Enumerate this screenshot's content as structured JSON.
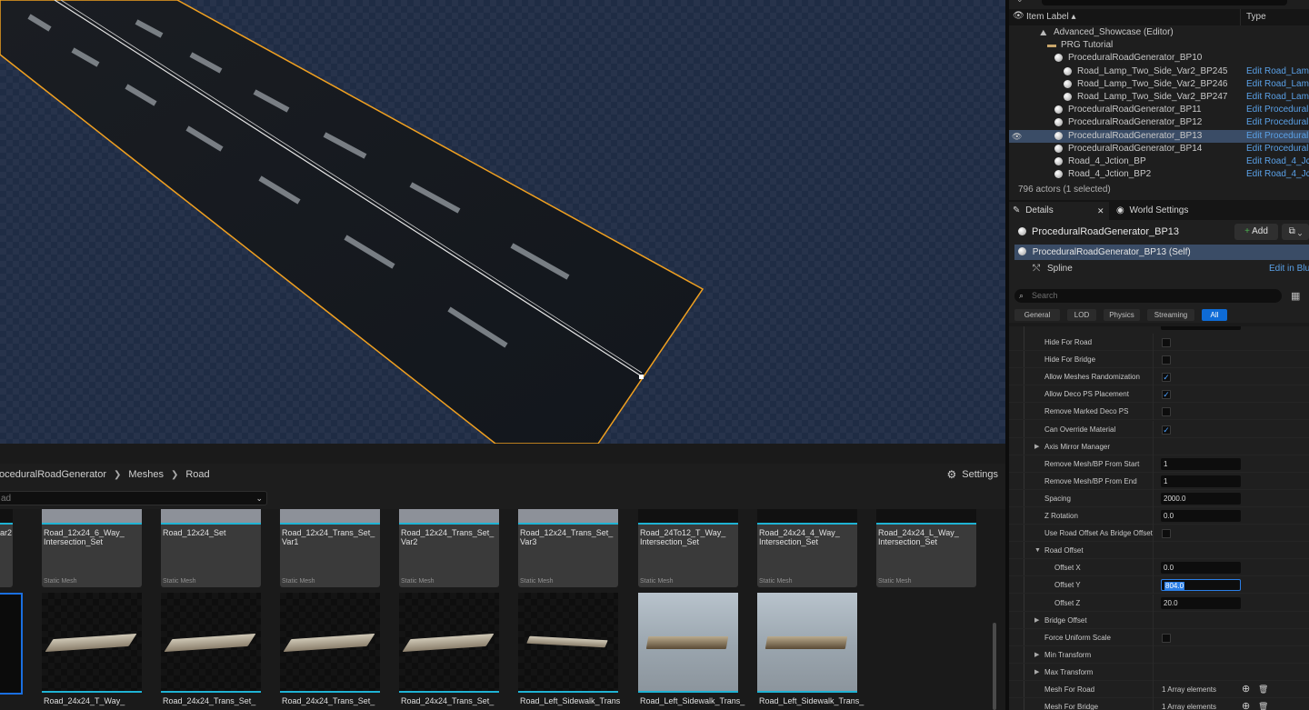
{
  "outliner": {
    "header": {
      "item_label": "Item Label ▴",
      "type": "Type"
    },
    "rows": [
      {
        "label": "Advanced_Showcase (Editor)",
        "type": ""
      },
      {
        "label": "PRG Tutorial",
        "type": ""
      },
      {
        "label": "ProceduralRoadGenerator_BP10",
        "type": ""
      },
      {
        "label": "Road_Lamp_Two_Side_Var2_BP245",
        "type": "Edit Road_Lamp"
      },
      {
        "label": "Road_Lamp_Two_Side_Var2_BP246",
        "type": "Edit Road_Lamp"
      },
      {
        "label": "Road_Lamp_Two_Side_Var2_BP247",
        "type": "Edit Road_Lamp"
      },
      {
        "label": "ProceduralRoadGenerator_BP11",
        "type": "Edit ProceduralR"
      },
      {
        "label": "ProceduralRoadGenerator_BP12",
        "type": "Edit ProceduralR"
      },
      {
        "label": "ProceduralRoadGenerator_BP13",
        "type": "Edit ProceduralR"
      },
      {
        "label": "ProceduralRoadGenerator_BP14",
        "type": "Edit ProceduralR"
      },
      {
        "label": "Road_4_Jction_BP",
        "type": "Edit Road_4_Jct"
      },
      {
        "label": "Road_4_Jction_BP2",
        "type": "Edit Road_4_Jct"
      }
    ],
    "actor_count": "796 actors (1 selected)"
  },
  "details": {
    "tab_details": "Details",
    "tab_world": "World Settings",
    "title": "ProceduralRoadGenerator_BP13",
    "add_label": "Add",
    "self_label": "ProceduralRoadGenerator_BP13 (Self)",
    "spline_label": "Spline",
    "spline_link": "Edit in Blu",
    "search_placeholder": "Search",
    "filters": [
      "General",
      "LOD",
      "Physics",
      "Streaming",
      "All"
    ],
    "active_filter": "All",
    "properties": [
      {
        "label": "Hide For Road",
        "kind": "check",
        "value": false
      },
      {
        "label": "Hide For Bridge",
        "kind": "check",
        "value": false
      },
      {
        "label": "Allow Meshes Randomization",
        "kind": "check",
        "value": true
      },
      {
        "label": "Allow Deco PS Placement",
        "kind": "check",
        "value": true
      },
      {
        "label": "Remove Marked Deco PS",
        "kind": "check",
        "value": false
      },
      {
        "label": "Can Override Material",
        "kind": "check",
        "value": true
      },
      {
        "label": "Axis Mirror Manager",
        "kind": "group"
      },
      {
        "label": "Remove Mesh/BP From Start",
        "kind": "number",
        "value": "1"
      },
      {
        "label": "Remove Mesh/BP From End",
        "kind": "number",
        "value": "1"
      },
      {
        "label": "Spacing",
        "kind": "number",
        "value": "2000.0"
      },
      {
        "label": "Z Rotation",
        "kind": "number",
        "value": "0.0"
      },
      {
        "label": "Use Road Offset As Bridge Offset",
        "kind": "check",
        "value": false
      },
      {
        "label": "Road Offset",
        "kind": "group-open"
      },
      {
        "label": "Offset X",
        "kind": "number",
        "value": "0.0",
        "indent": true
      },
      {
        "label": "Offset Y",
        "kind": "number",
        "value": "804.0",
        "indent": true,
        "focus": true
      },
      {
        "label": "Offset Z",
        "kind": "number",
        "value": "20.0",
        "indent": true
      },
      {
        "label": "Bridge Offset",
        "kind": "group"
      },
      {
        "label": "Force Uniform Scale",
        "kind": "check",
        "value": false
      },
      {
        "label": "Min Transform",
        "kind": "group"
      },
      {
        "label": "Max Transform",
        "kind": "group"
      },
      {
        "label": "Mesh For Road",
        "kind": "array",
        "value": "1 Array elements"
      },
      {
        "label": "Mesh For Bridge",
        "kind": "array",
        "value": "1 Array elements"
      }
    ]
  },
  "content_browser": {
    "path": [
      "oceduralRoadGenerator",
      "Meshes",
      "Road"
    ],
    "settings_label": "Settings",
    "search_value": "ad",
    "row1": [
      {
        "name": "ar2",
        "kind": ""
      },
      {
        "name": "Road_12x24_6_Way_ Intersection_Set",
        "kind": "Static Mesh"
      },
      {
        "name": "Road_12x24_Set",
        "kind": "Static Mesh"
      },
      {
        "name": "Road_12x24_Trans_Set_ Var1",
        "kind": "Static Mesh"
      },
      {
        "name": "Road_12x24_Trans_Set_ Var2",
        "kind": "Static Mesh"
      },
      {
        "name": "Road_12x24_Trans_Set_ Var3",
        "kind": "Static Mesh"
      },
      {
        "name": "Road_24To12_T_Way_ Intersection_Set",
        "kind": "Static Mesh"
      },
      {
        "name": "Road_24x24_4_Way_ Intersection_Set",
        "kind": "Static Mesh"
      },
      {
        "name": "Road_24x24_L_Way_ Intersection_Set",
        "kind": "Static Mesh"
      }
    ],
    "row2": [
      "Road_24x24_T_Way_",
      "Road_24x24_Trans_Set_",
      "Road_24x24_Trans_Set_",
      "Road_24x24_Trans_Set_",
      "Road_Left_Sidewalk_Trans",
      "Road_Left_Sidewalk_Trans_",
      "Road_Left_Sidewalk_Trans_"
    ]
  },
  "colors": {
    "accent": "#1fb3d4",
    "selection": "#3a4c66",
    "link": "#5aa0e6",
    "spline": "#f0a020",
    "filter_active": "#0e6bd6"
  }
}
